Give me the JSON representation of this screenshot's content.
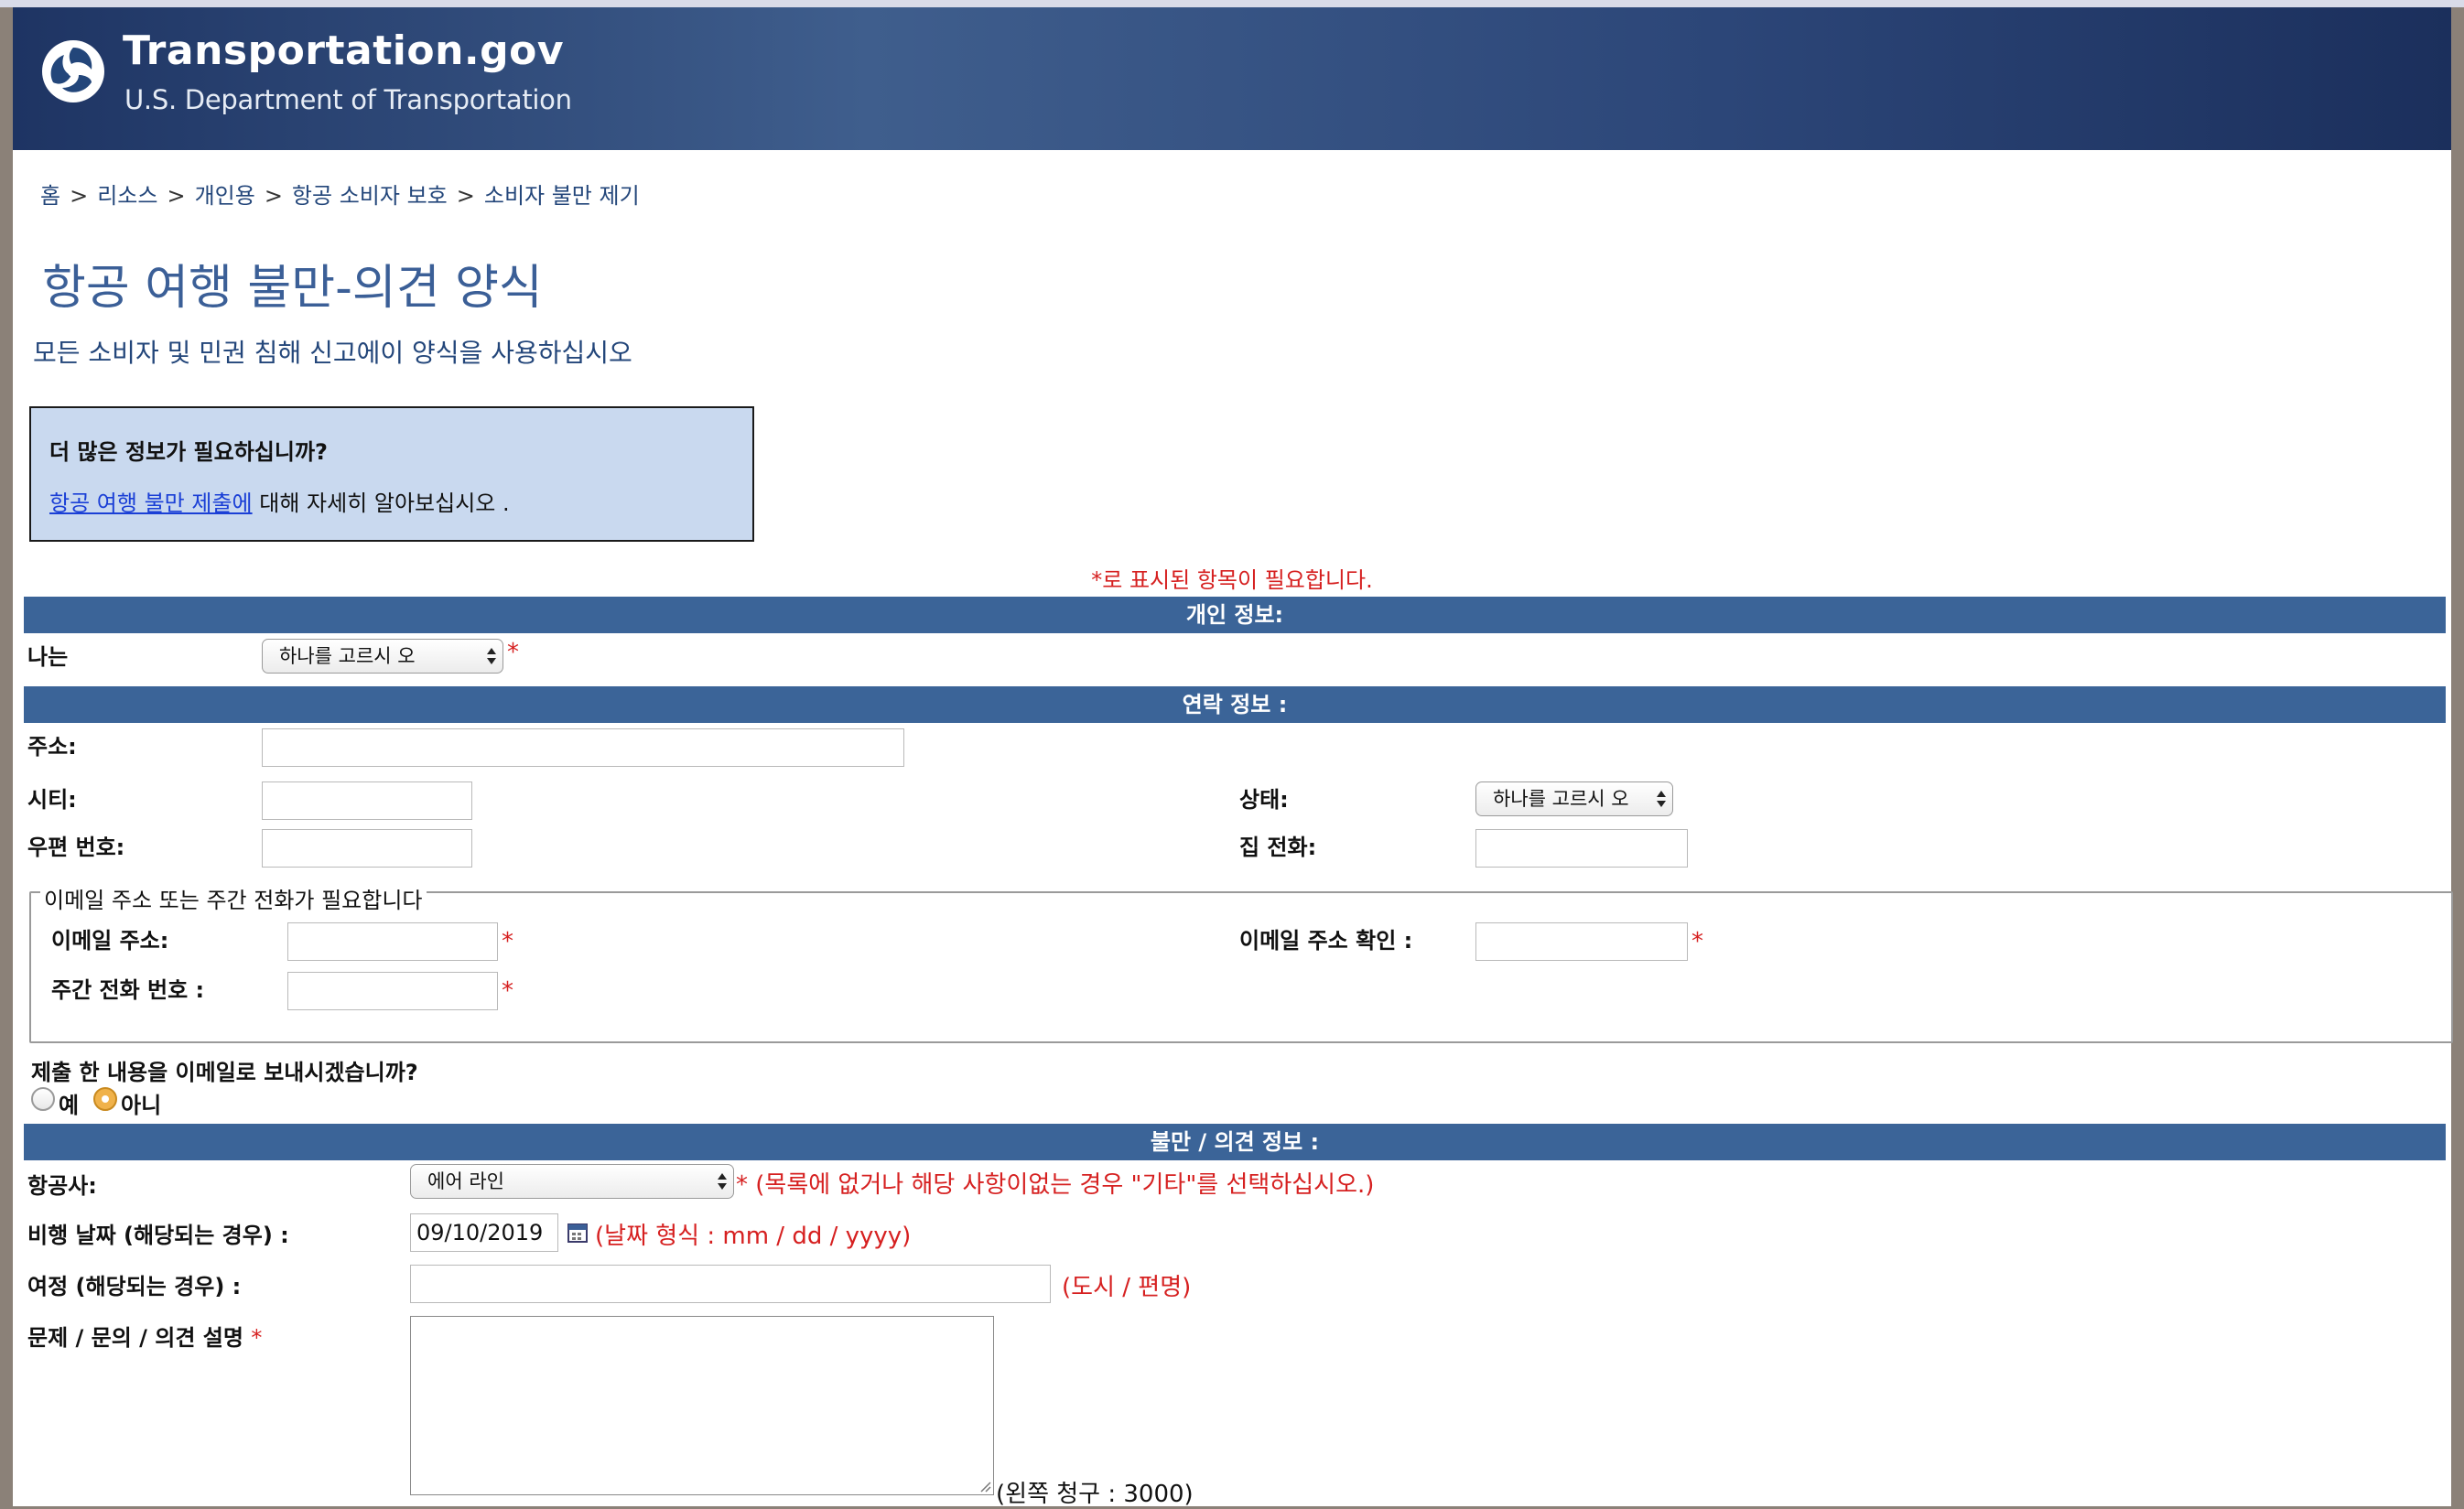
{
  "header": {
    "site_title": "Transportation.gov",
    "site_subtitle": "U.S. Department of Transportation",
    "logo_icon": "dot-triskelion-icon",
    "colors": {
      "banner": "#2c4678",
      "section_bar": "#3b6498",
      "required": "#d62020",
      "info_box": "#c9d9ef"
    }
  },
  "breadcrumb": {
    "items": [
      "홈",
      "리소스",
      "개인용",
      "항공 소비자 보호",
      "소비자 불만 제기"
    ],
    "separator": ">"
  },
  "page": {
    "title": "항공 여행 불만-의견 양식",
    "subtitle": "모든 소비자 및 민권 침해 신고에이 양식을 사용하십시오"
  },
  "info_box": {
    "title": "더 많은 정보가 필요하십니까?",
    "link_text": "항공 여행 불만 제출에",
    "after_link": " 대해 자세히 알아보십시오 ."
  },
  "required_note": "*로 표시된 항목이 필요합니다.",
  "sections": {
    "personal": "개인 정보:",
    "contact": "연락 정보 :",
    "complaint": "불만 / 의견 정보 :"
  },
  "personal": {
    "i_am_label": "나는",
    "i_am_value": "하나를 고르시 오"
  },
  "contact": {
    "address_label": "주소:",
    "city_label": "시티:",
    "state_label": "상태:",
    "state_value": "하나를 고르시 오",
    "zip_label": "우편 번호:",
    "home_phone_label": "집 전화:",
    "fieldset_legend": "이메일 주소 또는 주간 전화가 필요합니다",
    "email_label": "이메일 주소:",
    "email_confirm_label": "이메일 주소 확인 :",
    "day_phone_label": "주간 전화 번호 :",
    "send_copy_question": "제출 한 내용을 이메일로 보내시겠습니까?",
    "yes_label": "예",
    "no_label": "아니",
    "selected": "아니"
  },
  "complaint": {
    "airline_label": "항공사:",
    "airline_value": "에어 라인",
    "airline_hint": " (목록에 없거나 해당 사항이없는 경우 \"기타\"를 선택하십시오.)",
    "flight_date_label": "비행 날짜 (해당되는 경우) :",
    "flight_date_value": "09/10/2019",
    "date_hint": "(날짜 형식 : mm / dd / yyyy)",
    "itinerary_label": "여정 (해당되는 경우) :",
    "itinerary_hint": "(도시 / 편명)",
    "description_label": "문제 / 문의 / 의견 설명",
    "counter": "(왼쪽 청구 : 3000)"
  },
  "required_mark": "*"
}
